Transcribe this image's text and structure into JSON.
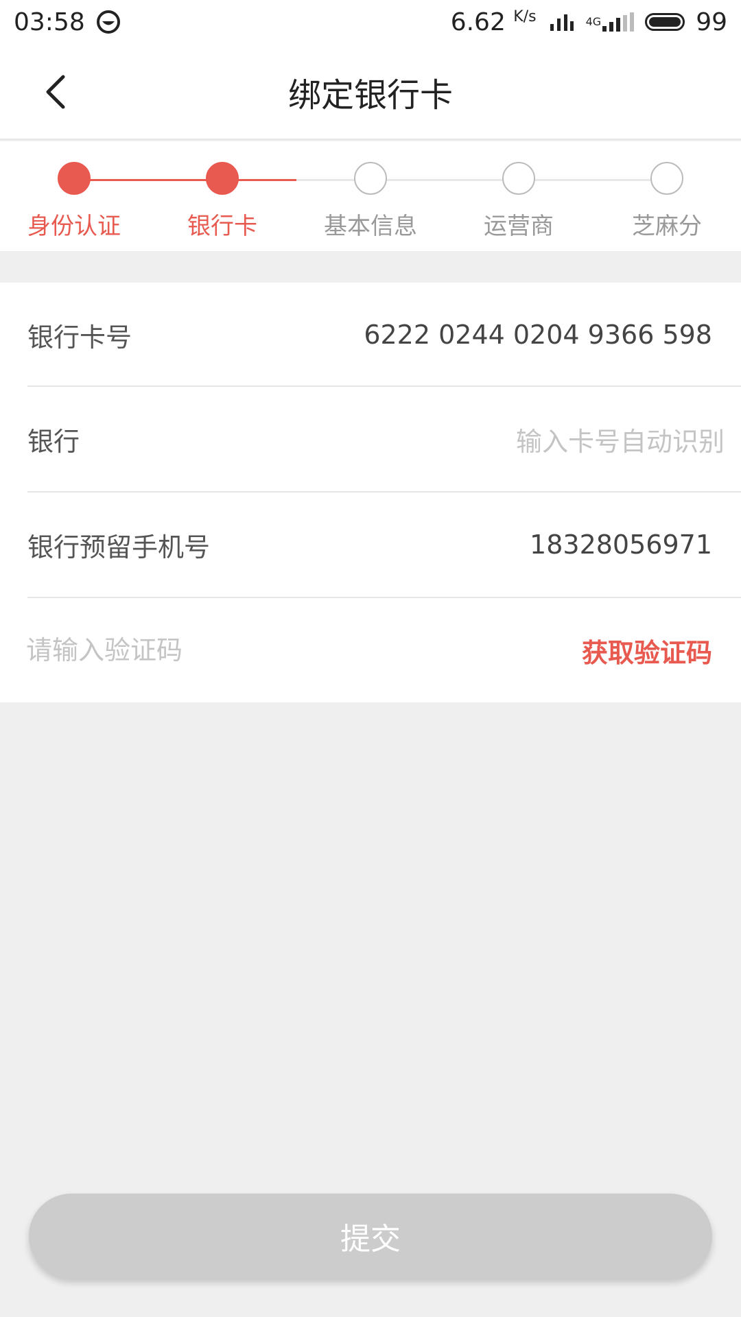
{
  "status_bar": {
    "time": "03:58",
    "network_speed": "6.62",
    "speed_unit": "K/s",
    "network_type": "4G",
    "battery": "99"
  },
  "header": {
    "title": "绑定银行卡"
  },
  "steps": [
    {
      "label": "身份认证",
      "active": true
    },
    {
      "label": "银行卡",
      "active": true
    },
    {
      "label": "基本信息",
      "active": false
    },
    {
      "label": "运营商",
      "active": false
    },
    {
      "label": "芝麻分",
      "active": false
    }
  ],
  "form": {
    "card_number_label": "银行卡号",
    "card_number_value": "6222 0244 0204 9366 598",
    "bank_label": "银行",
    "bank_placeholder": "输入卡号自动识别",
    "phone_label": "银行预留手机号",
    "phone_value": "18328056971",
    "code_placeholder": "请输入验证码",
    "get_code_label": "获取验证码"
  },
  "submit_label": "提交",
  "colors": {
    "accent": "#e85a4f",
    "disabled_button": "#cccccc",
    "background": "#efefef"
  }
}
